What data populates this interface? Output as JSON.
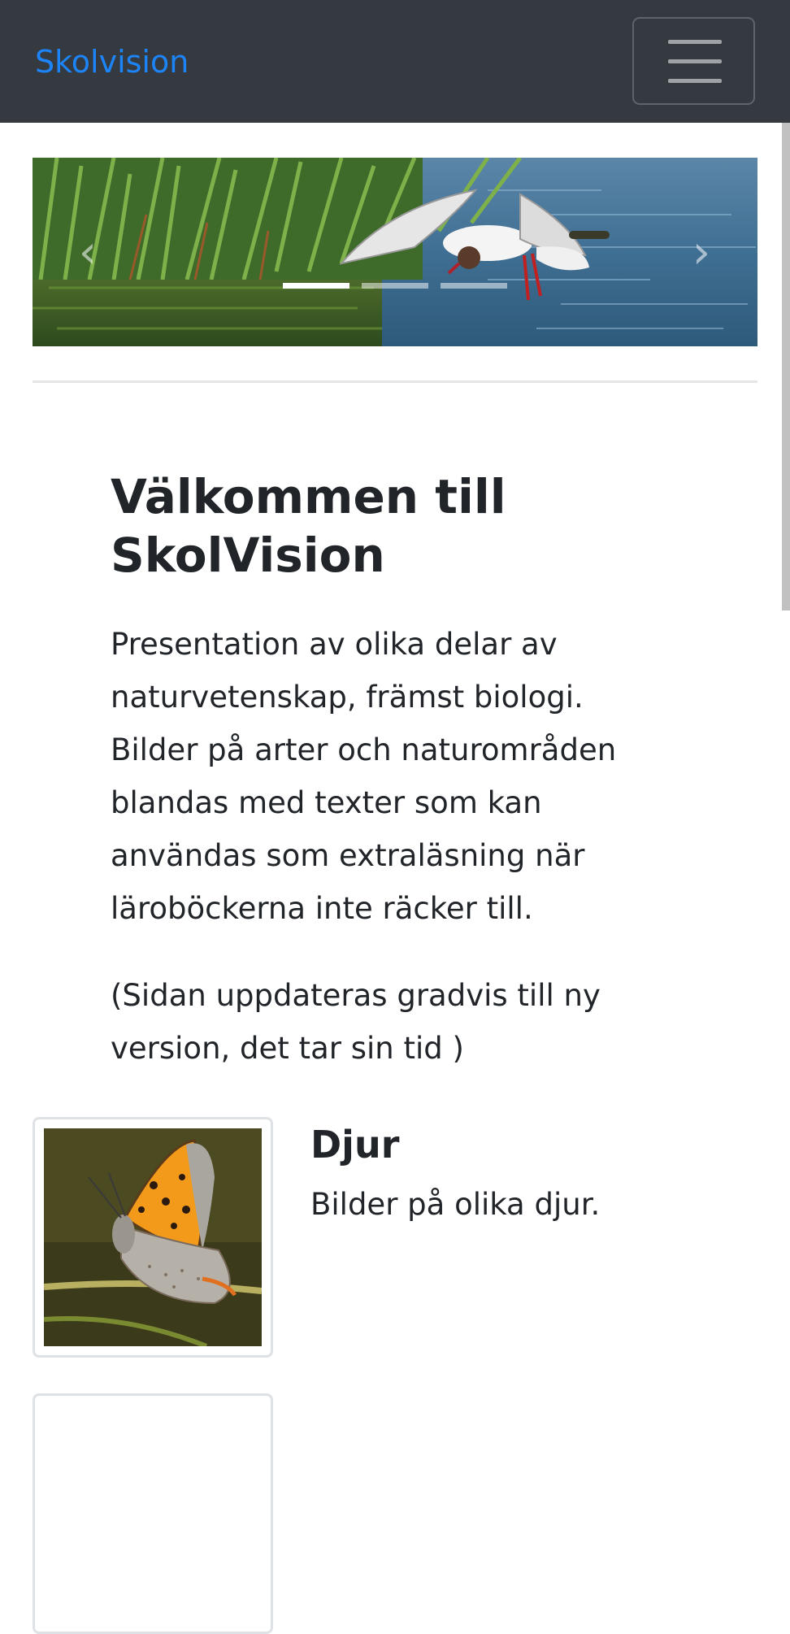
{
  "navbar": {
    "brand": "Skolvision",
    "toggle_icon": "hamburger-menu-icon"
  },
  "carousel": {
    "prev_icon": "chevron-left-icon",
    "next_icon": "chevron-right-icon",
    "slide_count": 3,
    "active_slide": 1
  },
  "welcome": {
    "title": "Välkommen till SkolVision",
    "intro": "Presentation av olika delar av naturvetenskap, främst biologi. Bilder på arter och naturområden blandas med texter som kan användas som extraläsning när läroböckerna inte räcker till.",
    "note": "(Sidan uppdateras gradvis till ny version, det tar sin tid )"
  },
  "sections": [
    {
      "title": "Djur",
      "text": "Bilder på olika djur."
    }
  ],
  "colors": {
    "navbar_bg": "#343a40",
    "brand": "#1d84f7",
    "text": "#212529"
  }
}
